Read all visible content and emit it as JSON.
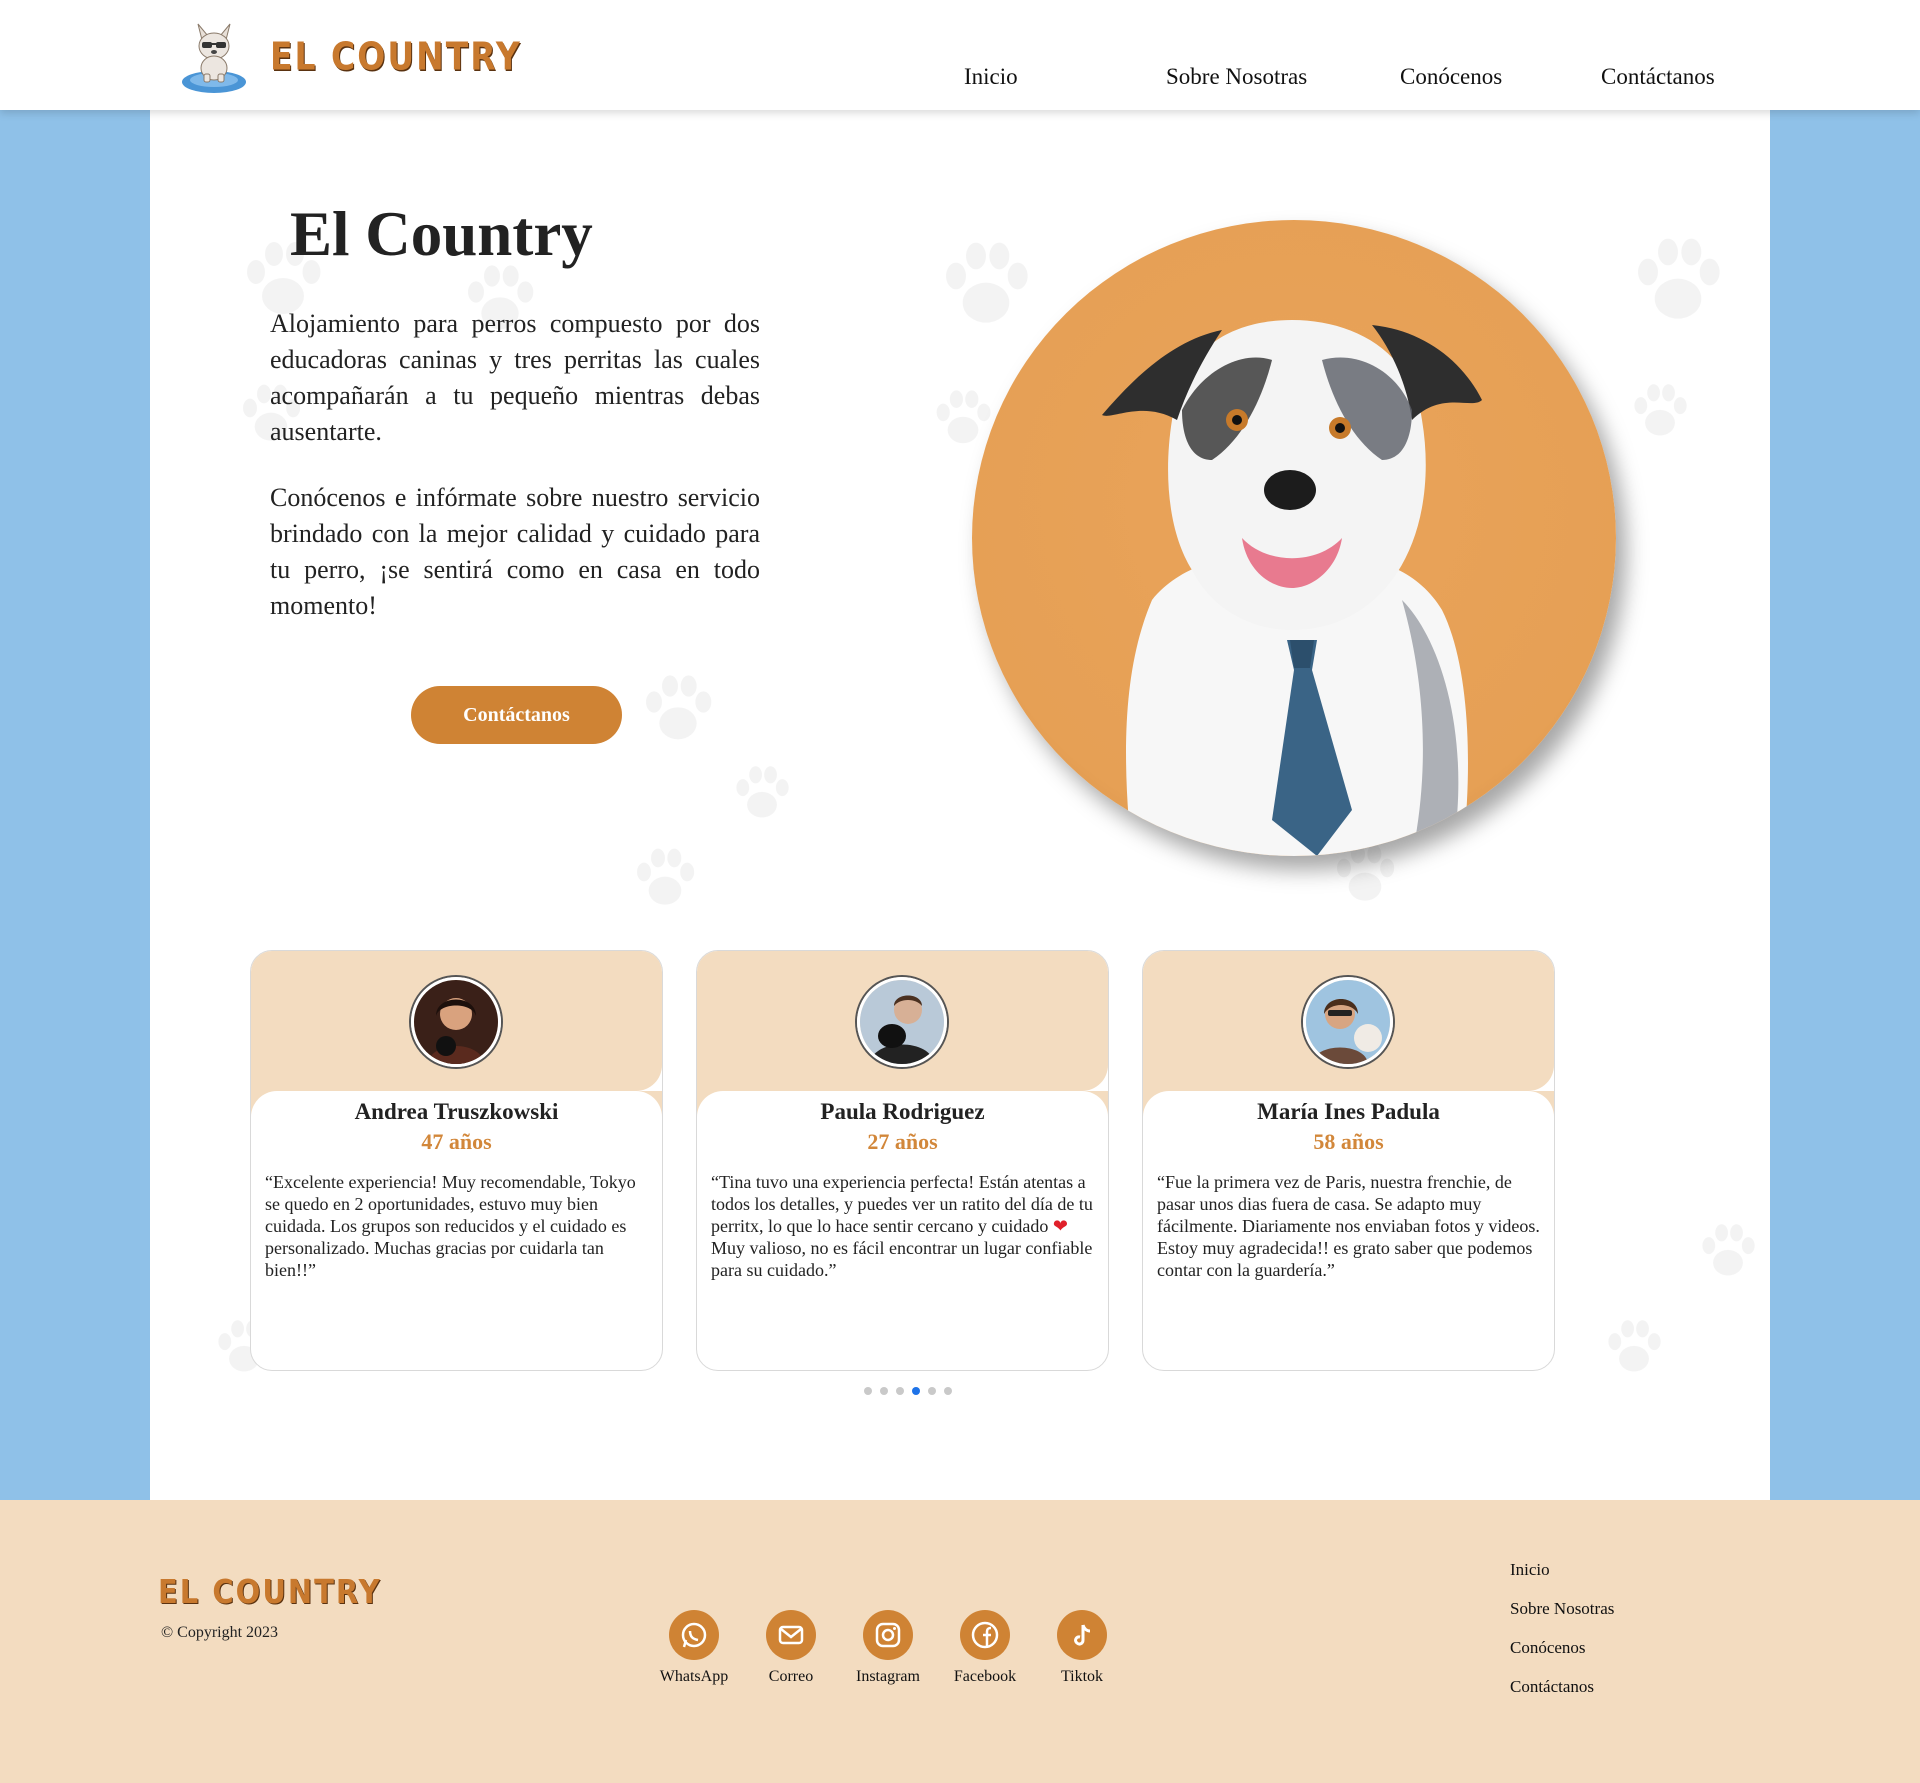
{
  "brand": {
    "name": "EL COUNTRY"
  },
  "nav": {
    "items": [
      "Inicio",
      "Sobre Nosotras",
      "Conócenos",
      "Contáctanos"
    ]
  },
  "hero": {
    "title": "El Country",
    "paragraphs": [
      "Alojamiento para perros compuesto por dos educadoras caninas y tres perritas las cuales acompañarán a tu pequeño mientras debas ausentarte.",
      "Conócenos e infórmate sobre nuestro servicio brindado con la mejor calidad y cuidado para tu perro, ¡se sentirá como en casa en todo momento!"
    ],
    "cta_label": "Contáctanos"
  },
  "testimonials": [
    {
      "name": "Andrea Truszkowski",
      "age": "47 años",
      "text": "“Excelente experiencia! Muy recomendable, Tokyo se quedo en 2 oportunidades, estuvo muy bien cuidada. Los grupos son reducidos y el cuidado es personalizado. Muchas gracias por cuidarla tan bien!!”"
    },
    {
      "name": "Paula Rodriguez",
      "age": "27 años",
      "text_before": "“Tina tuvo una experiencia perfecta! Están atentas a todos los detalles, y puedes ver un ratito del día de tu perritx, lo que lo hace sentir cercano y cuidado",
      "text_after": "Muy valioso, no es fácil encontrar un lugar confiable para su cuidado.”",
      "emoji": "❤️"
    },
    {
      "name": "María Ines Padula",
      "age": "58 años",
      "text": "“Fue la primera vez de Paris, nuestra frenchie, de pasar unos dias fuera de casa. Se adapto muy fácilmente. Diariamente nos enviaban fotos y videos. Estoy muy agradecida!! es grato saber que podemos contar con la guardería.”"
    }
  ],
  "carousel": {
    "dot_count": 6,
    "active_index": 3
  },
  "footer": {
    "logo": "EL COUNTRY",
    "copyright": "© Copyright 2023",
    "social": [
      {
        "label": "WhatsApp",
        "icon": "whatsapp-icon"
      },
      {
        "label": "Correo",
        "icon": "mail-icon"
      },
      {
        "label": "Instagram",
        "icon": "instagram-icon"
      },
      {
        "label": "Facebook",
        "icon": "facebook-icon"
      },
      {
        "label": "Tiktok",
        "icon": "tiktok-icon"
      }
    ],
    "links": [
      "Inicio",
      "Sobre Nosotras",
      "Conócenos",
      "Contáctanos"
    ]
  },
  "colors": {
    "accent": "#cf8334",
    "side_background": "#8fc1e8",
    "card_header": "#f3dcc0",
    "footer_background": "#f3dcc0",
    "active_dot": "#1e73e8"
  }
}
